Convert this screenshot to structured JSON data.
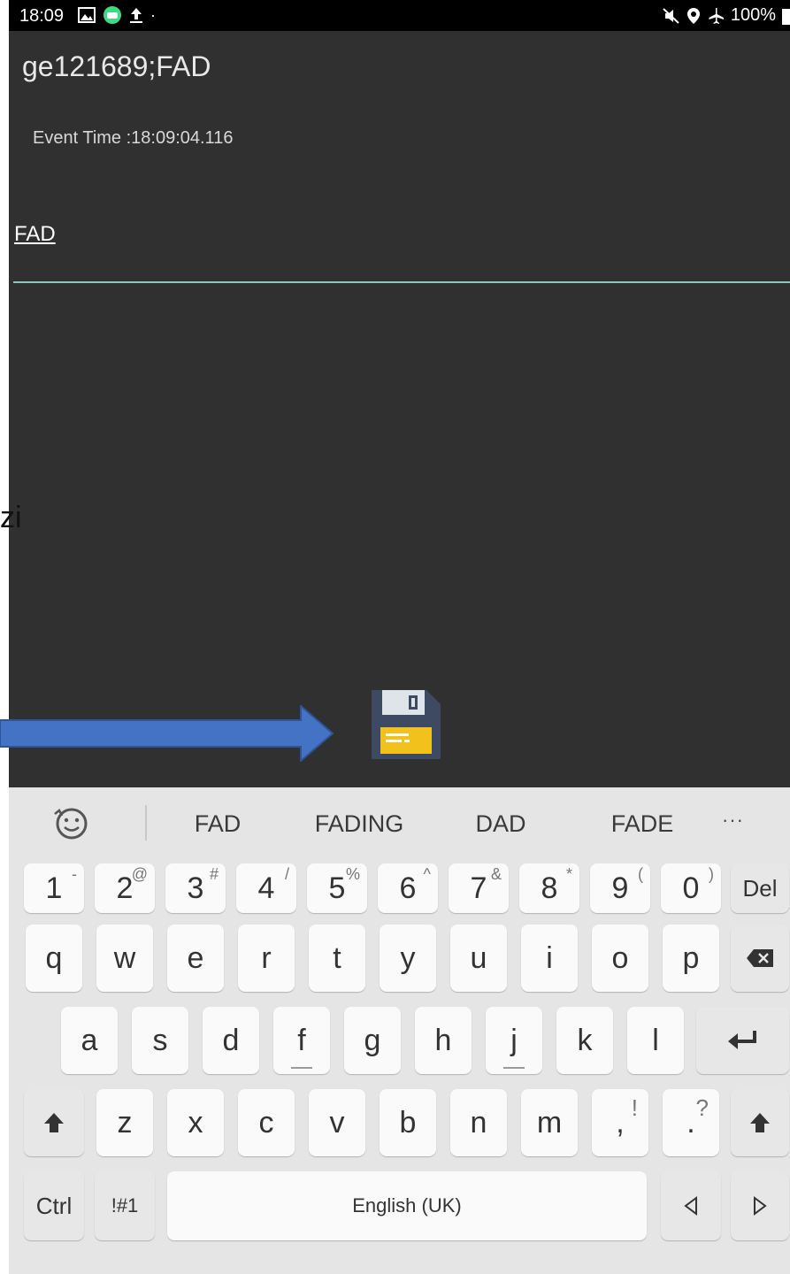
{
  "status_bar": {
    "time": "18:09",
    "battery": "100%"
  },
  "app": {
    "title": "ge121689;FAD",
    "event_time": "Event Time :18:09:04.116",
    "input_value": "FAD"
  },
  "overlay": {
    "side_text": "zi",
    "arrow_color": "#4472c4"
  },
  "keyboard": {
    "suggestions": [
      "FAD",
      "FADING",
      "DAD",
      "FADE"
    ],
    "more": "···",
    "row1": [
      {
        "label": "1",
        "hint": "-"
      },
      {
        "label": "2",
        "hint": "@"
      },
      {
        "label": "3",
        "hint": "#"
      },
      {
        "label": "4",
        "hint": "/"
      },
      {
        "label": "5",
        "hint": "%"
      },
      {
        "label": "6",
        "hint": "^"
      },
      {
        "label": "7",
        "hint": "&"
      },
      {
        "label": "8",
        "hint": "*"
      },
      {
        "label": "9",
        "hint": "("
      },
      {
        "label": "0",
        "hint": ")"
      }
    ],
    "del_label": "Del",
    "row2": [
      "q",
      "w",
      "e",
      "r",
      "t",
      "y",
      "u",
      "i",
      "o",
      "p"
    ],
    "row3": [
      "a",
      "s",
      "d",
      "f",
      "g",
      "h",
      "j",
      "k",
      "l"
    ],
    "row4": [
      "z",
      "x",
      "c",
      "v",
      "b",
      "n",
      "m"
    ],
    "row4_punct": [
      {
        "label": ",",
        "hint": "!"
      },
      {
        "label": ".",
        "hint": "?"
      }
    ],
    "ctrl_label": "Ctrl",
    "symbols_label": "!#1",
    "space_label": "English (UK)"
  }
}
